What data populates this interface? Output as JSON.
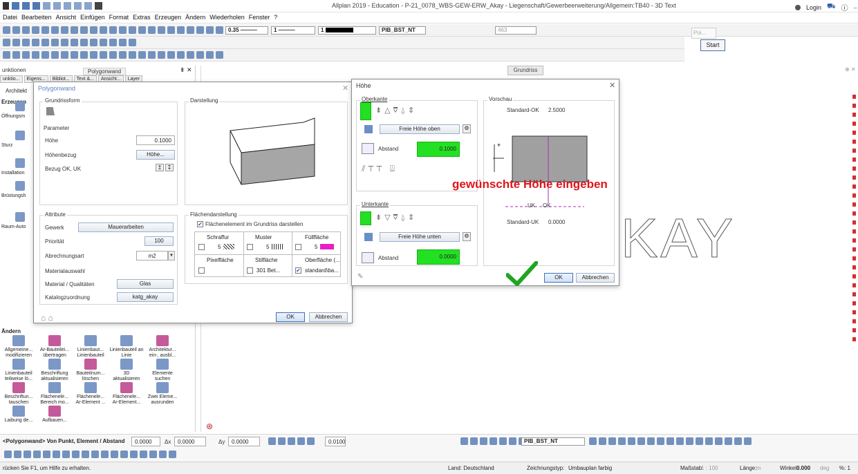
{
  "app": {
    "title": "Allplan 2019 - Education - P-21_0078_WBS-GEW-ERW_Akay - Liegenschaft/Gewerbeerweiterung/Allgemein:TB40 - 3D Text",
    "login": "Login",
    "menu": [
      "Datei",
      "Bearbeiten",
      "Ansicht",
      "Einfügen",
      "Format",
      "Extras",
      "Erzeugen",
      "Ändern",
      "Wiederholen",
      "Fenster",
      "?"
    ]
  },
  "toolbar": {
    "pen": "0.35",
    "line": "1",
    "color": "1",
    "layer": "PIB_BST_NT",
    "counter": "463",
    "poi_placeholder": "Poi...",
    "start": "Start"
  },
  "left_panel": {
    "title": "unktionen",
    "subtitle": "Polygonwand",
    "tabs": [
      "unktio...",
      "Eigens...",
      "Bibliot...",
      "Text &...",
      "Ansicht...",
      "Layer"
    ],
    "erzeugen_label": "Erzeugen",
    "side_items": [
      "Öffnungsm",
      "Sturz",
      "Installation",
      "Brüstungsh",
      "Raum-Auto"
    ],
    "architektur": "Architekt",
    "aendern_label": "Ändern",
    "tools": [
      "Allgemeine... modifizieren",
      "Ar-Bauteilei... übertragen",
      "Linienbaut... Linienbauteil",
      "Linienbauteil an Linie",
      "Architektur... ein-, ausbl...",
      "Linienbauteil teilweise lö...",
      "Beschriftung aktualisieren",
      "Bauteilnum... löschen",
      "3D aktualisieren",
      "Elemente suchen",
      "Beschriftun... tauschen",
      "Flächenele... Bereich mo...",
      "Flächenele... Ar-Element ...",
      "Flächenele... Ar-Element...",
      "Zwei Eleme... ausrunden",
      "Laibung de...",
      "Aufbauen..."
    ]
  },
  "canvas": {
    "tab": "Grundriss",
    "akay_text": "KAY"
  },
  "polygonwand_dialog": {
    "title": "Polygonwand",
    "grundrissform": "Grundrissform",
    "darstellung": "Darstellung",
    "parameter": "Parameter",
    "hoehe_label": "Höhe",
    "hoehe_value": "0.1000",
    "hoehenbezug_label": "Höhenbezug",
    "hoehe_button": "Höhe...",
    "bezug_label": "Bezug OK, UK",
    "attribute": "Attribute",
    "gewerk_label": "Gewerk",
    "gewerk_value": "Mauerarbeiten",
    "prioritaet_label": "Priorität",
    "prioritaet_value": "100",
    "abrechnungsart_label": "Abrechnungsart",
    "abrechnungsart_value": "m2",
    "materialauswahl": "Materialauswahl",
    "material_label": "Material / Qualitäten",
    "material_value": "Glas",
    "katalog_label": "Katalogzuordnung",
    "katalog_value": "katg_akay",
    "flaechendarstellung": "Flächendarstellung",
    "flaechenelement_chk": "Flächenelement im Grundriss darstellen",
    "table_header1": [
      "Schraffur",
      "Muster",
      "Füllfläche"
    ],
    "table_row1": [
      "5",
      "5",
      "5"
    ],
    "table_header2": [
      "Pixelfläche",
      "Stilfläche",
      "Oberfläche (..."
    ],
    "table_row2": [
      "",
      "301 Bet...",
      "standard\\ba..."
    ],
    "ok": "OK",
    "abbrechen": "Abbrechen"
  },
  "hoehe_dialog": {
    "title": "Höhe",
    "oberkante": "Oberkante",
    "freie_hoehe_oben": "Freie Höhe oben",
    "abstand_label": "Abstand",
    "abstand_oben_value": "0.1000",
    "unterkante": "Unterkante",
    "freie_hoehe_unten": "Freie Höhe unten",
    "abstand_unten_value": "0.0000",
    "vorschau": "Vorschau",
    "standard_ok_label": "Standard-OK",
    "standard_ok_value": "2.5000",
    "standard_uk_label": "Standard-UK",
    "standard_uk_value": "0.0000",
    "uk": "UK",
    "ok_tag": "OK",
    "ok": "OK",
    "abbrechen": "Abbrechen"
  },
  "annotation": {
    "text": "gewünschte Höhe eingeben",
    "color": "#e0141b",
    "check_color": "#1fa61f",
    "highlight_color": "#22e022"
  },
  "command_bar": {
    "prompt": "<Polygonwand> Von Punkt, Element / Abstand",
    "abstand_value": "0.0000",
    "dx_label": "Δx",
    "dx_value": "0.0000",
    "dy_label": "Δy",
    "dy_value": "0.0000",
    "grid_value": "0.0100",
    "layer_value": "PIB_BST_NT"
  },
  "status_bar": {
    "help": "rücken Sie F1, um Hilfe zu erhalten.",
    "land": "Land: Deutschland",
    "zeichnungstyp_label": "Zeichnungstyp:",
    "zeichnungstyp_value": "Umbauplan farbig",
    "massstab_label": "Maßstab:",
    "massstab_value": "1 : 100",
    "laenge_label": "Länge:",
    "laenge_value": "m",
    "winkel_label": "Winkel:",
    "winkel_value": "0.000",
    "winkel_unit": "deg",
    "percent": "%: 1"
  }
}
